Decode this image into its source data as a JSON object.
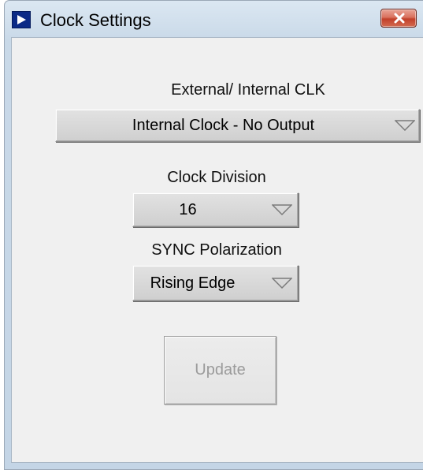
{
  "window": {
    "title": "Clock Settings",
    "close_icon": "close-icon",
    "app_icon": "play-arrow-icon"
  },
  "clock_source": {
    "label": "External/ Internal CLK",
    "value": "Internal Clock - No Output"
  },
  "clock_division": {
    "label": "Clock Division",
    "value": "16"
  },
  "sync_polarization": {
    "label": "SYNC Polarization",
    "value": "Rising Edge"
  },
  "update_button": {
    "label": "Update",
    "enabled": false
  },
  "colors": {
    "title_accent": "#0b2a86",
    "close_button": "#c2402a",
    "panel_background": "#f0f0f0",
    "disabled_text": "#9b9b9b"
  }
}
